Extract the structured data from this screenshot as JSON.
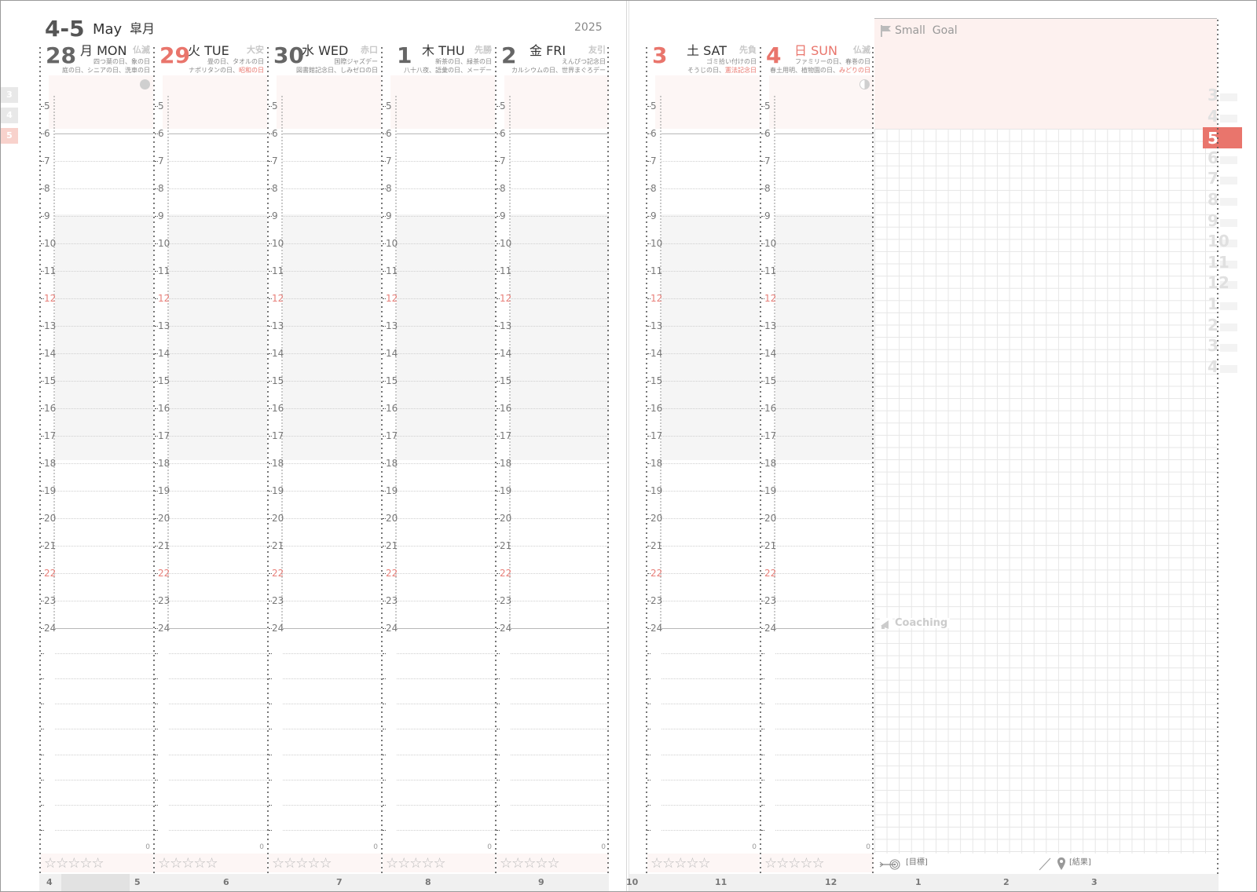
{
  "header": {
    "week_range": "4-5",
    "month_en": "May",
    "month_jp": "皐月",
    "year": "2025"
  },
  "days": [
    {
      "num": "28",
      "name": "月 MON",
      "rokuyo": "仏滅",
      "memo1": "四つ葉の日、象の日",
      "memo2": "庭の日、シニアの日、洗車の日",
      "memo2_red": "",
      "red": false
    },
    {
      "num": "29",
      "name": "火 TUE",
      "rokuyo": "大安",
      "memo1": "畳の日、タオルの日",
      "memo2": "ナポリタンの日、",
      "memo2_red": "昭和の日",
      "red": true
    },
    {
      "num": "30",
      "name": "水 WED",
      "rokuyo": "赤口",
      "memo1": "国際ジャズデー",
      "memo2": "図書館記念日、しみゼロの日",
      "memo2_red": "",
      "red": false
    },
    {
      "num": "1",
      "name": "木 THU",
      "rokuyo": "先勝",
      "memo1": "新茶の日、緑茶の日",
      "memo2": "八十八夜、語彙の日、メーデー",
      "memo2_red": "",
      "red": false
    },
    {
      "num": "2",
      "name": "金 FRI",
      "rokuyo": "友引",
      "memo1": "えんぴつ記念日",
      "memo2": "カルシウムの日、世界まぐろデー",
      "memo2_red": "",
      "red": false
    },
    {
      "num": "3",
      "name": "土 SAT",
      "rokuyo": "先負",
      "memo1": "ゴミ拾い付けの日",
      "memo2": "そうじの日、",
      "memo2_red": "憲法記念日",
      "red": true,
      "name_red": false
    },
    {
      "num": "4",
      "name": "日 SUN",
      "rokuyo": "仏滅",
      "memo1": "ファミリーの日、春巻の日",
      "memo2": "春土用明、植物園の日、",
      "memo2_red": "みどりの日",
      "red": true,
      "name_red": true
    }
  ],
  "hours": [
    "5",
    "6",
    "7",
    "8",
    "9",
    "10",
    "11",
    "12",
    "13",
    "14",
    "15",
    "16",
    "17",
    "18",
    "19",
    "20",
    "21",
    "22",
    "23",
    "24"
  ],
  "stars": "☆☆☆☆☆",
  "zero": "0",
  "small_goal_label": "Small  Goal",
  "coaching_label": "Coaching",
  "goal_label": "[目標]",
  "result_label": "[結果]",
  "footer_left": [
    "4",
    "5",
    "6",
    "7",
    "8",
    "9"
  ],
  "footer_right": [
    "10",
    "11",
    "12",
    "1",
    "2",
    "3"
  ],
  "left_months": [
    "3",
    "4",
    "5"
  ],
  "right_months": [
    "3",
    "4",
    "5",
    "6",
    "7",
    "8",
    "9",
    "10",
    "11",
    "12",
    "1",
    "2",
    "3",
    "4"
  ],
  "colors": {
    "accent": "#e9756c",
    "band": "#fdf6f5",
    "gray": "#f5f5f5"
  },
  "icons": {
    "small_goal": "flag-icon",
    "coaching": "megaphone-icon",
    "goal": "target-icon",
    "result": "pin-icon",
    "moon_full": "full-moon-icon",
    "moon_half": "half-moon-icon"
  }
}
